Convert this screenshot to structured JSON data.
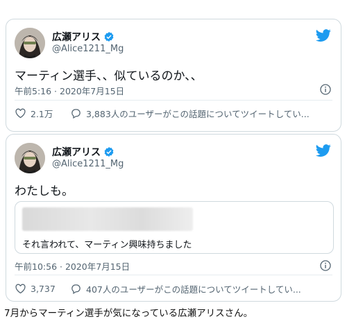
{
  "tweets": [
    {
      "user": {
        "display_name": "広瀬アリス",
        "handle": "@Alice1211_Mg"
      },
      "text": "マーティン選手、、似ているのか、、",
      "timestamp": "午前5:16 · 2020年7月15日",
      "likes": "2.1万",
      "conversation": "3,883人のユーザーがこの話題についてツイートしてい..."
    },
    {
      "user": {
        "display_name": "広瀬アリス",
        "handle": "@Alice1211_Mg"
      },
      "text": "わたしも。",
      "quote_text": "それ言われて、マーティン興味持ちました",
      "timestamp": "午前10:56 · 2020年7月15日",
      "likes": "3,737",
      "conversation": "407人のユーザーがこの話題についてツイートしてい..."
    }
  ],
  "caption": "7月からマーティン選手が気になっている広瀬アリスさん。",
  "colors": {
    "twitter_blue": "#1d9bf0",
    "border": "#cfd9de",
    "secondary_text": "#536471"
  },
  "icons": [
    "twitter-bird-icon",
    "verified-badge-icon",
    "info-icon",
    "heart-icon",
    "reply-bubble-icon"
  ]
}
